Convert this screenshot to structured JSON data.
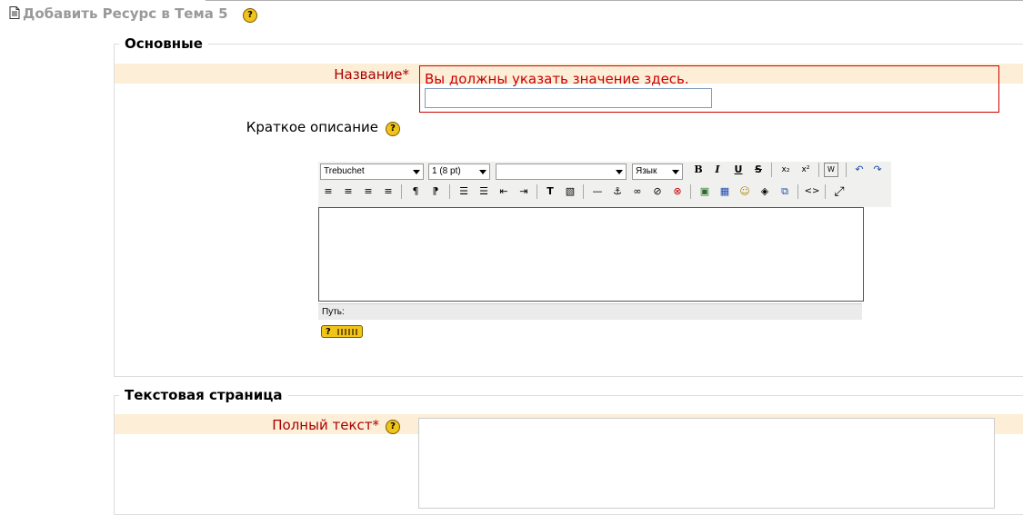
{
  "header": {
    "title": "Добавить Ресурс в Тема 5",
    "icon": "document-icon",
    "help_glyph": "?"
  },
  "sections": {
    "general": {
      "legend": "Основные",
      "name": {
        "label": "Название",
        "required_mark": "*",
        "error": "Вы должны указать значение здесь.",
        "value": ""
      },
      "summary": {
        "label": "Краткое описание"
      }
    },
    "text_page": {
      "legend": "Текстовая страница",
      "full_text": {
        "label": "Полный текст",
        "required_mark": "*"
      }
    }
  },
  "editor": {
    "font_family": "Trebuchet",
    "font_size": "1 (8 pt)",
    "format": "",
    "language": "Язык",
    "path_label": "Путь:",
    "buttons_row1": [
      "B",
      "I",
      "U",
      "S",
      "x₂",
      "x²",
      "W",
      "↶",
      "↷"
    ],
    "buttons_row2": [
      "≡",
      "≡",
      "≡",
      "≡",
      "¶",
      "¶",
      "☰",
      "☰",
      "⇤",
      "⇥",
      "T",
      "▧",
      "—",
      "⚓",
      "∞",
      "⊘",
      "⊗",
      "▣",
      "▦",
      "☺",
      "◈",
      "⧉",
      "<>",
      "⤢"
    ]
  },
  "colors": {
    "required_band": "#fdeed7",
    "error": "#cc0000",
    "required_label": "#aa0000",
    "help_icon": "#f0c419"
  }
}
